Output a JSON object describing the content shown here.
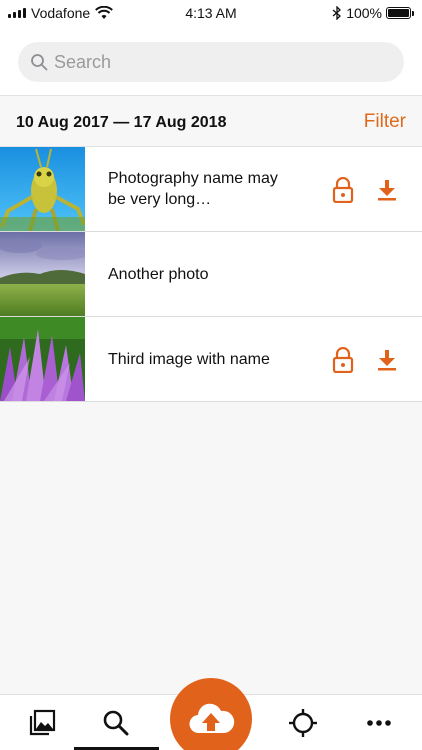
{
  "status_bar": {
    "carrier": "Vodafone",
    "time": "4:13 AM",
    "battery": "100%"
  },
  "search": {
    "placeholder": "Search",
    "icon": "search-icon"
  },
  "range": {
    "dates": "10 Aug 2017 — 17 Aug 2018",
    "filter_label": "Filter"
  },
  "photos": [
    {
      "name": "Photography name may be very long…",
      "locked": true,
      "downloadable": true
    },
    {
      "name": "Another photo",
      "locked": false,
      "downloadable": false
    },
    {
      "name": "Third image with name",
      "locked": true,
      "downloadable": true
    }
  ],
  "tabs": [
    {
      "icon": "gallery-icon",
      "active": false
    },
    {
      "icon": "search-icon",
      "active": true
    },
    {
      "icon": "upload-cloud-icon",
      "active": false
    },
    {
      "icon": "crosshair-icon",
      "active": false
    },
    {
      "icon": "more-icon",
      "active": false
    }
  ],
  "colors": {
    "accent": "#e0621b",
    "text": "#111111",
    "background": "#f7f7f7"
  }
}
